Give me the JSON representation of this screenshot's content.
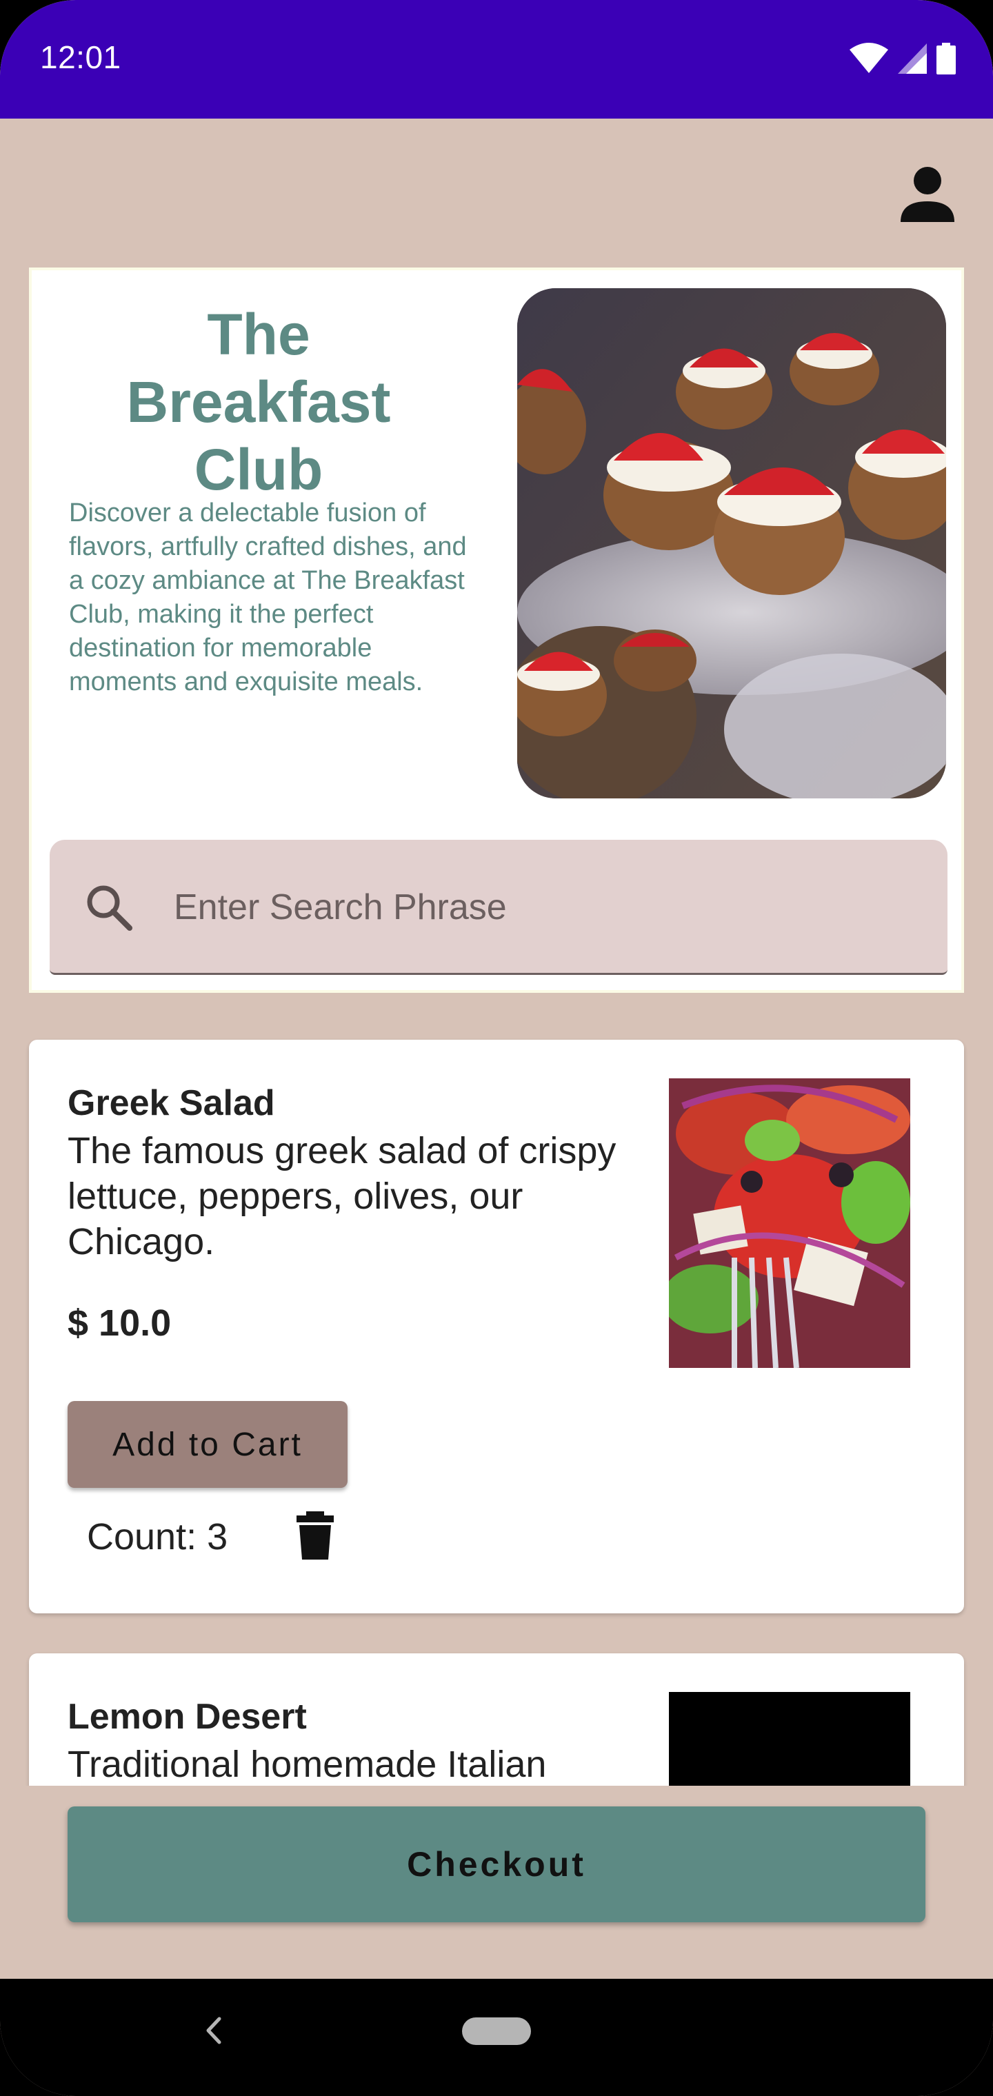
{
  "status_bar": {
    "time": "12:01",
    "icons": [
      "wifi-icon",
      "cellular-signal-icon",
      "battery-icon"
    ],
    "background": "#3b00b6"
  },
  "header": {
    "profile_icon": "person-icon"
  },
  "hero": {
    "title": "The Breakfast Club",
    "description": "Discover a delectable fusion of flavors, artfully crafted dishes, and a cozy ambiance at The Breakfast Club, making it the perfect destination for memorable moments and exquisite meals.",
    "image": "strawberry-cream-tartlets-photo",
    "accent": "#5d8a84"
  },
  "search": {
    "placeholder": "Enter Search Phrase",
    "value": "",
    "icon": "search-icon"
  },
  "menu_items": [
    {
      "name": "Greek Salad",
      "description": "The famous greek salad of crispy lettuce, peppers, olives, our Chicago.",
      "price": "$ 10.0",
      "image": "greek-salad-photo",
      "add_label": "Add to Cart",
      "count_label": "Count: 3",
      "remove_icon": "trash-icon"
    },
    {
      "name": "Lemon Desert",
      "description": "Traditional homemade Italian",
      "image": "lemon-dessert-photo"
    }
  ],
  "checkout": {
    "label": "Checkout"
  },
  "colors": {
    "background": "#d7c2b7",
    "primary_green": "#5d8a84",
    "add_button": "#9b817b",
    "search_bg": "#e2d0cf"
  }
}
